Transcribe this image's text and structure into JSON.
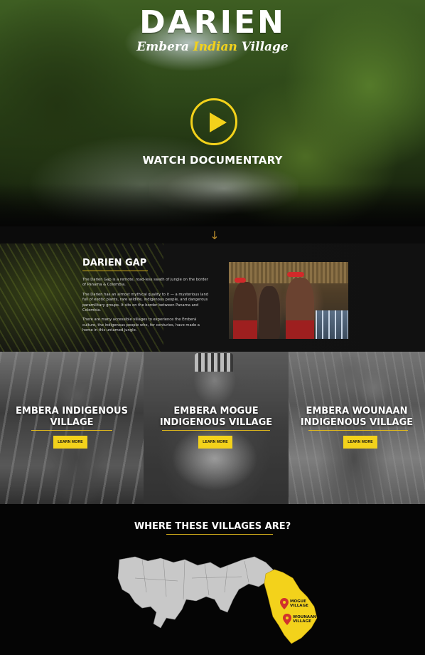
{
  "hero": {
    "title": "DARIEN",
    "subtitle_words": [
      "Embera",
      "Indian",
      "Village"
    ],
    "watch_label": "WATCH DOCUMENTARY"
  },
  "gap": {
    "title": "DARIEN GAP",
    "paragraphs": [
      "The Darien Gap is a remote, road-less swath of jungle on the border of Panama & Colombia.",
      "The Darien has an almost mythical quality to it — a mysterious land full of exotic plants, rare wildlife, indigenous people, and dangerous paramilitary groups. It sits on the border between Panama and Colombia.",
      "There are many accessible villages to experience the Emberá culture, the indigenous people who, for centuries, have made a home in this untamed jungle."
    ]
  },
  "villages": [
    {
      "title_line1": "EMBERA INDIGENOUS",
      "title_line2": "VILLAGE",
      "button": "LEARN MORE"
    },
    {
      "title_line1": "EMBERA MOGUE",
      "title_line2": "INDIGENOUS VILLAGE",
      "button": "LEARN MORE"
    },
    {
      "title_line1": "EMBERA WOUNAAN",
      "title_line2": "INDIGENOUS VILLAGE",
      "button": "LEARN MORE"
    }
  ],
  "map": {
    "title": "WHERE THESE VILLAGES ARE?",
    "markers": [
      {
        "line1": "MOGUE",
        "line2": "VILLAGE"
      },
      {
        "line1": "WOUNAAN",
        "line2": "VILLAGE"
      }
    ]
  },
  "colors": {
    "accent": "#f3d21b",
    "map_gray": "#c8c8c8",
    "map_region": "#f3d21b",
    "marker_red": "#d0312d",
    "background": "#0b0b0b"
  }
}
